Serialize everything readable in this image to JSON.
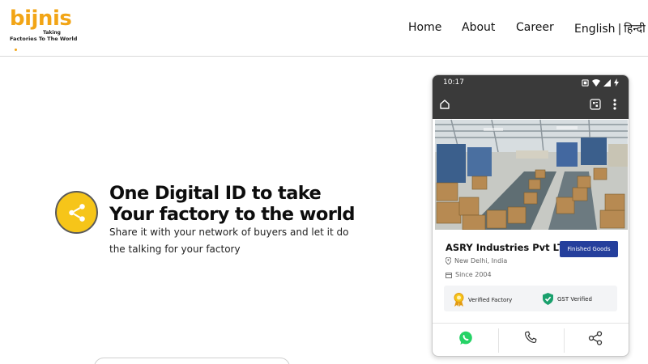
{
  "header": {
    "logo": {
      "word": "bijnis",
      "taking": "Taking",
      "tagline": "Factories To The World"
    },
    "nav": {
      "home": "Home",
      "about": "About",
      "career": "Career",
      "lang_english": "English",
      "lang_sep": "|",
      "lang_hindi": "हिन्दी"
    }
  },
  "hero": {
    "title_line1": "One Digital ID to take",
    "title_line2": "Your factory to the world",
    "subtitle_line1": "Share it with your network of buyers and let it do",
    "subtitle_line2": "the talking for your factory",
    "icon": "share-icon"
  },
  "phone": {
    "status_time": "10:17",
    "company_name": "ASRY Industries Pvt LTD",
    "category_button": "Finished Goods",
    "location": "New Delhi, India",
    "since": "Since 2004",
    "verified_factory": "Verified Factory",
    "gst_verified": "GST Verified",
    "actions": [
      "whatsapp-icon",
      "phone-icon",
      "share-icon"
    ]
  },
  "colors": {
    "brand_yellow": "#f6c519",
    "logo_orange": "#f2a516",
    "button_blue": "#253f9c",
    "whatsapp_green": "#25d366",
    "gst_green": "#1aa06d",
    "phone_bar": "#3a3a3a"
  }
}
